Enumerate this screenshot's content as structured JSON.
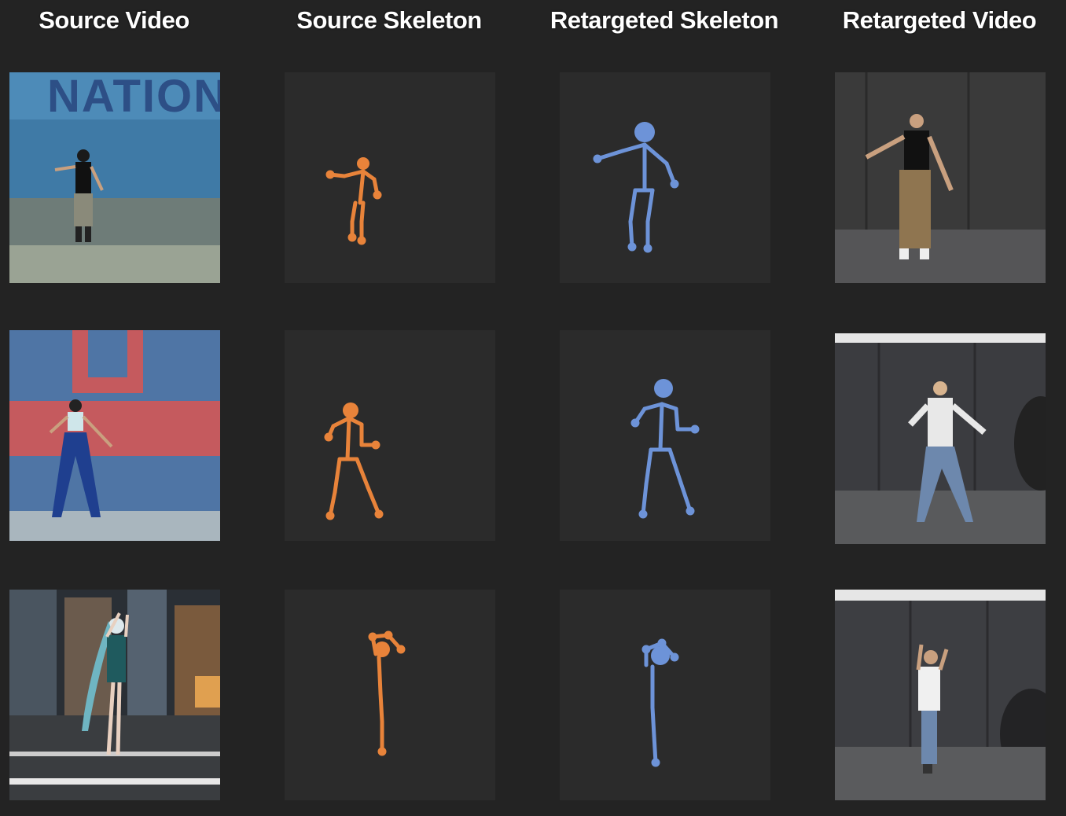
{
  "headers": {
    "source_video": "Source Video",
    "source_skeleton": "Source Skeleton",
    "retargeted_skeleton": "Retargeted Skeleton",
    "retargeted_video": "Retargeted Video"
  },
  "rows": [
    {
      "source_banner_text": "NATIONA"
    },
    {},
    {}
  ],
  "colors": {
    "background": "#232323",
    "skeleton_panel": "#2b2b2b",
    "source_skeleton": "#e8833a",
    "retargeted_skeleton": "#6d93d8"
  }
}
